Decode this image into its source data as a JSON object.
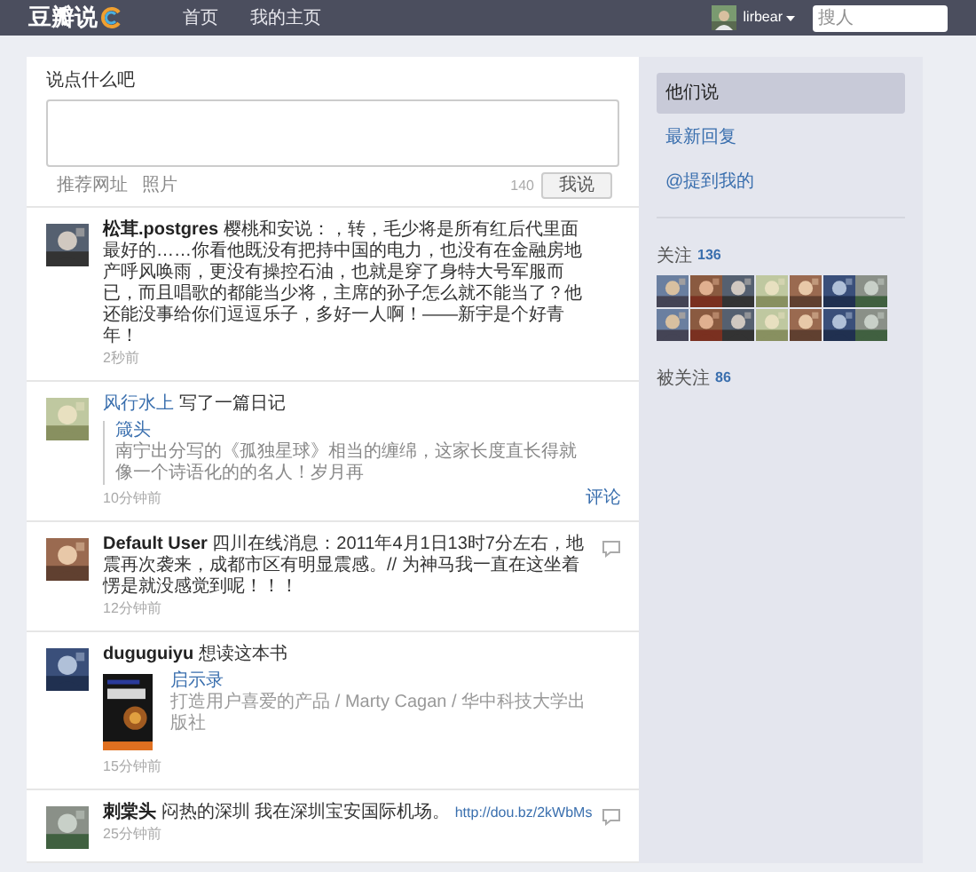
{
  "header": {
    "logo": "豆瓣说",
    "nav": [
      {
        "label": "首页",
        "selected": false
      },
      {
        "label": "我的主页",
        "selected": false
      }
    ],
    "user": "lirbear",
    "search": {
      "placeholder": "搜人"
    }
  },
  "composer": {
    "title": "说点什么吧",
    "tools": [
      "推荐网址",
      "照片"
    ],
    "counter": "140",
    "button": "我说"
  },
  "feed": [
    {
      "kind": "status",
      "author": "松茸.postgres",
      "text": "樱桃和安说：，转，毛少将是所有红后代里面最好的……你看他既没有把持中国的电力，也没有在金融房地产呼风唤雨，更没有操控石油，也就是穿了身特大号军服而已，而且唱歌的都能当少将，主席的孙子怎么就不能当了？他还能没事给你们逗逗乐子，多好一人啊！——新宇是个好青年！",
      "time": "2秒前",
      "comment_icon": false
    },
    {
      "kind": "note",
      "author": "风行水上",
      "text": "写了一篇日记",
      "quote_title": "箴头",
      "quote_text": "南宁出分写的《孤独星球》相当的缠绵，这家长度直长得就像一个诗语化的的名人！岁月再",
      "time": "10分钟前",
      "action": "评论",
      "comment_icon": false
    },
    {
      "kind": "status",
      "author": "Default User",
      "text": "四川在线消息：2011年4月1日13时7分左右，地震再次袭来，成都市区有明显震感。// 为神马我一直在这坐着愣是就没感觉到呢！！！",
      "time": "12分钟前",
      "comment_icon": true
    },
    {
      "kind": "book",
      "author": "duguguiyu",
      "text": "想读这本书",
      "book_title": "启示录",
      "book_info": "打造用户喜爱的产品 / Marty Cagan / 华中科技大学出版社",
      "time": "15分钟前",
      "comment_icon": false
    },
    {
      "kind": "link",
      "author": "刺棠头",
      "text": "闷热的深圳 我在深圳宝安国际机场。",
      "link": "http://dou.bz/2kWbMs",
      "time": "25分钟前",
      "comment_icon": true
    }
  ],
  "sidebar": {
    "tabs": [
      {
        "label": "他们说",
        "selected": true
      },
      {
        "label": "最新回复",
        "selected": false
      },
      {
        "label": "@提到我的",
        "selected": false
      }
    ],
    "following": {
      "label": "关注",
      "count": "136"
    },
    "followers": {
      "label": "被关注",
      "count": "86"
    }
  }
}
